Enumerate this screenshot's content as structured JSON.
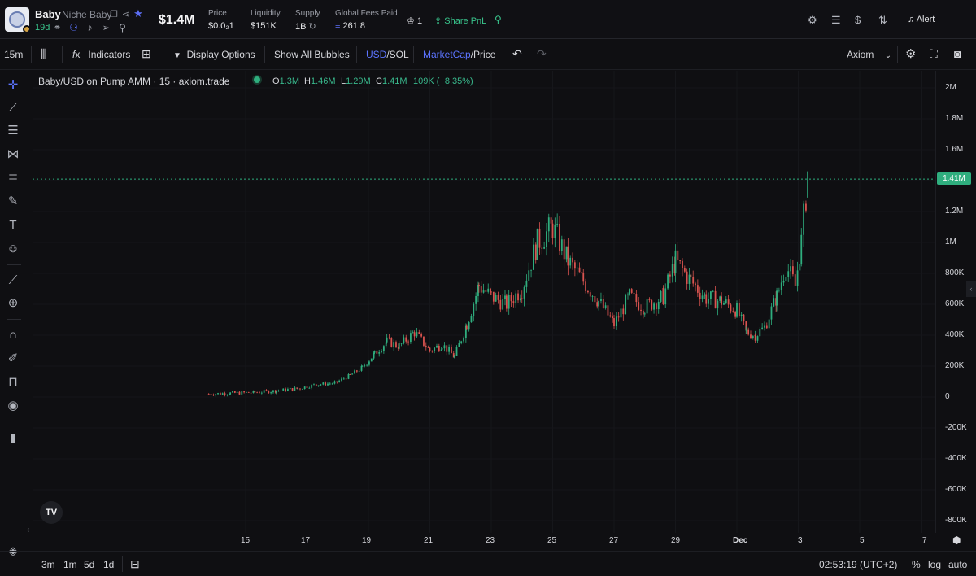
{
  "token": {
    "name": "Baby",
    "full_name": "Niche Baby",
    "age": "19d",
    "market_cap": "$1.4M",
    "stats": [
      {
        "label": "Price",
        "value": "$0.0₂1"
      },
      {
        "label": "Liquidity",
        "value": "$151K"
      },
      {
        "label": "Supply",
        "value": "1B"
      },
      {
        "label": "Global Fees Paid",
        "value": "261.8"
      }
    ],
    "holders_count": "1",
    "share_label": "Share PnL",
    "alert_label": "Alert"
  },
  "toolbar": {
    "interval": "15m",
    "indicators": "Indicators",
    "display_options": "Display Options",
    "show_bubbles": "Show All Bubbles",
    "currency_active": "USD",
    "currency_other": "/SOL",
    "metric_active": "MarketCap",
    "metric_other": "/Price",
    "source": "Axiom"
  },
  "legend": {
    "title": "Baby/USD on Pump AMM · 15 · axiom.trade",
    "o_key": "O",
    "o": "1.3M",
    "h_key": "H",
    "h": "1.46M",
    "l_key": "L",
    "l": "1.29M",
    "c_key": "C",
    "c": "1.41M",
    "change": "109K (+8.35%)"
  },
  "price_tag": "1.41M",
  "chart_data": {
    "type": "candlestick",
    "y_ticks": [
      "2M",
      "1.8M",
      "1.6M",
      "1.4M",
      "1.2M",
      "1M",
      "800K",
      "600K",
      "400K",
      "200K",
      "0",
      "-200K",
      "-400K",
      "-600K",
      "-800K"
    ],
    "x_ticks": [
      "15",
      "17",
      "19",
      "21",
      "23",
      "25",
      "27",
      "29",
      "Dec",
      "3",
      "5",
      "7"
    ],
    "ylim": [
      -850000,
      2100000
    ],
    "last_value": 1410000,
    "up_color": "#2fae7e",
    "down_color": "#d9534f",
    "series": [
      {
        "name": "",
        "points": [
          {
            "x": 13.8,
            "y": 20000
          },
          {
            "x": 14.5,
            "y": 25000
          },
          {
            "x": 15.3,
            "y": 30000
          },
          {
            "x": 16.0,
            "y": 40000
          },
          {
            "x": 16.7,
            "y": 55000
          },
          {
            "x": 17.3,
            "y": 80000
          },
          {
            "x": 17.9,
            "y": 90000
          },
          {
            "x": 18.4,
            "y": 140000
          },
          {
            "x": 18.8,
            "y": 190000
          },
          {
            "x": 19.2,
            "y": 280000
          },
          {
            "x": 19.6,
            "y": 360000
          },
          {
            "x": 20.0,
            "y": 330000
          },
          {
            "x": 20.5,
            "y": 420000
          },
          {
            "x": 21.0,
            "y": 300000
          },
          {
            "x": 21.4,
            "y": 340000
          },
          {
            "x": 21.8,
            "y": 260000
          },
          {
            "x": 22.2,
            "y": 470000
          },
          {
            "x": 22.6,
            "y": 720000
          },
          {
            "x": 23.0,
            "y": 650000
          },
          {
            "x": 23.5,
            "y": 600000
          },
          {
            "x": 24.0,
            "y": 700000
          },
          {
            "x": 24.5,
            "y": 1000000
          },
          {
            "x": 25.0,
            "y": 1100000
          },
          {
            "x": 25.5,
            "y": 880000
          },
          {
            "x": 26.0,
            "y": 750000
          },
          {
            "x": 26.5,
            "y": 620000
          },
          {
            "x": 27.0,
            "y": 470000
          },
          {
            "x": 27.5,
            "y": 650000
          },
          {
            "x": 28.0,
            "y": 580000
          },
          {
            "x": 28.6,
            "y": 650000
          },
          {
            "x": 29.0,
            "y": 880000
          },
          {
            "x": 29.5,
            "y": 750000
          },
          {
            "x": 30.0,
            "y": 640000
          },
          {
            "x": 30.5,
            "y": 620000
          },
          {
            "x": 31.0,
            "y": 560000
          },
          {
            "x": 31.3,
            "y": 420000
          },
          {
            "x": 31.6,
            "y": 400000
          },
          {
            "x": 31.9,
            "y": 450000
          },
          {
            "x": 32.3,
            "y": 650000
          },
          {
            "x": 32.6,
            "y": 850000
          },
          {
            "x": 32.9,
            "y": 720000
          },
          {
            "x": 33.1,
            "y": 1000000
          },
          {
            "x": 33.3,
            "y": 1410000
          }
        ]
      }
    ]
  },
  "bottom": {
    "ranges": [
      "3m",
      "1m",
      "5d",
      "1d"
    ],
    "clock": "02:53:19 (UTC+2)",
    "percent": "%",
    "log": "log",
    "auto": "auto"
  }
}
